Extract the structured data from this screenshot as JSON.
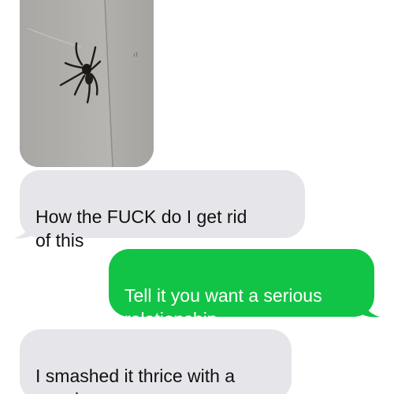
{
  "conversation": {
    "photo": {
      "icon": "spider-photo"
    },
    "messages": [
      {
        "direction": "incoming",
        "text": "How the FUCK do I get rid\nof this"
      },
      {
        "direction": "outgoing",
        "text": "Tell it you want a serious\nrelationship"
      },
      {
        "direction": "incoming",
        "text": "I smashed it thrice with a\nwooden spoon"
      }
    ]
  },
  "colors": {
    "incoming_bubble": "#e5e5ea",
    "outgoing_bubble": "#12c445",
    "incoming_text": "#111111",
    "outgoing_text": "#ffffff"
  }
}
